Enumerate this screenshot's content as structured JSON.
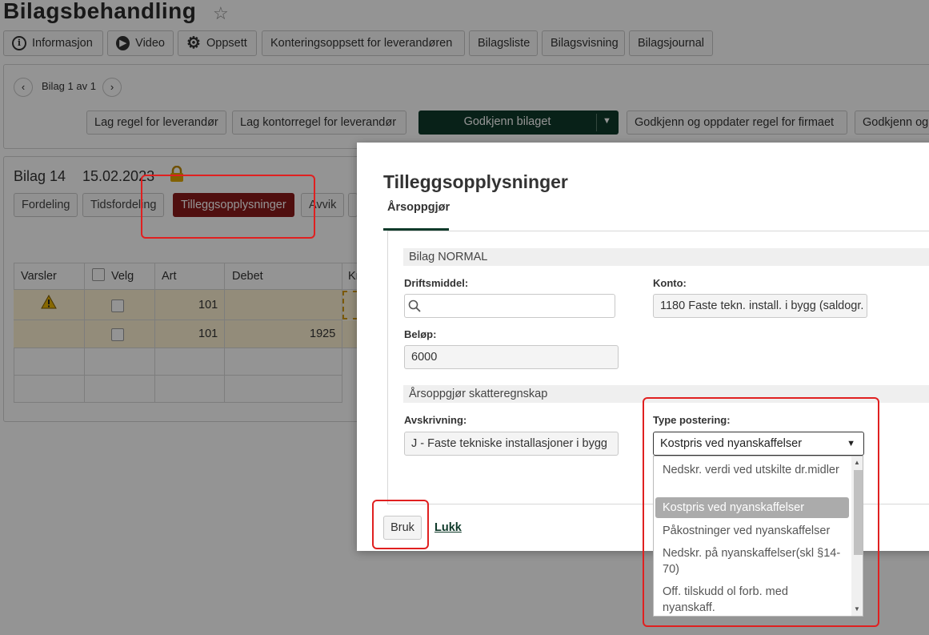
{
  "page": {
    "title": "Bilagsbehandling",
    "top_buttons": {
      "informasjon": "Informasjon",
      "video": "Video",
      "oppsett": "Oppsett",
      "konteringsoppsett": "Konteringsoppsett for leverandøren",
      "bilagsliste": "Bilagsliste",
      "bilagsvisning": "Bilagsvisning",
      "bilagsjournal": "Bilagsjournal"
    },
    "pager": "Bilag 1 av 1",
    "actions": {
      "lag_regel": "Lag regel for leverandør",
      "lag_kontorregel": "Lag kontorregel for leverandør",
      "godkjenn": "Godkjenn bilaget",
      "godkjenn_oppdater": "Godkjenn og oppdater regel for firmaet",
      "godkjenn_og": "Godkjenn og"
    },
    "bilag": {
      "label": "Bilag 14",
      "date": "15.02.2023"
    },
    "tabs": {
      "fordeling": "Fordeling",
      "tidsfordeling": "Tidsfordeling",
      "tilleggsopplysninger": "Tilleggsopplysninger",
      "avvik": "Avvik"
    },
    "grid": {
      "headers": {
        "varsler": "Varsler",
        "velg": "Velg",
        "art": "Art",
        "debet": "Debet",
        "kredit": "Kr"
      },
      "rows": [
        {
          "art": "101",
          "debet": ""
        },
        {
          "art": "101",
          "debet": "1925"
        }
      ]
    }
  },
  "modal": {
    "title": "Tilleggsopplysninger",
    "tab": "Årsoppgjør",
    "section1": "Bilag NORMAL",
    "driftsmiddel_label": "Driftsmiddel:",
    "driftsmiddel_value": "",
    "konto_label": "Konto:",
    "konto_value": "1180 Faste tekn. install. i bygg (saldogr.",
    "belop_label": "Beløp:",
    "belop_value": "6000",
    "section2": "Årsoppgjør skatteregnskap",
    "avskrivning_label": "Avskrivning:",
    "avskrivning_value": "J - Faste tekniske installasjoner i bygg",
    "type_label": "Type postering:",
    "type_value": "Kostpris ved nyanskaffelser",
    "type_options": [
      "Nedskr. verdi ved utskilte dr.midler",
      "Kostpris ved nyanskaffelser",
      "Påkostninger ved nyanskaffelser",
      "Nedskr. på nyanskaffelser(skl §14-70)",
      "Off. tilskudd ol forb. med nyanskaff."
    ],
    "bruk": "Bruk",
    "lukk": "Lukk"
  },
  "colors": {
    "accent_green": "#0f3a2a",
    "active_tab": "#8b1a1a",
    "highlight": "#e02020",
    "warning": "#e8b400"
  }
}
